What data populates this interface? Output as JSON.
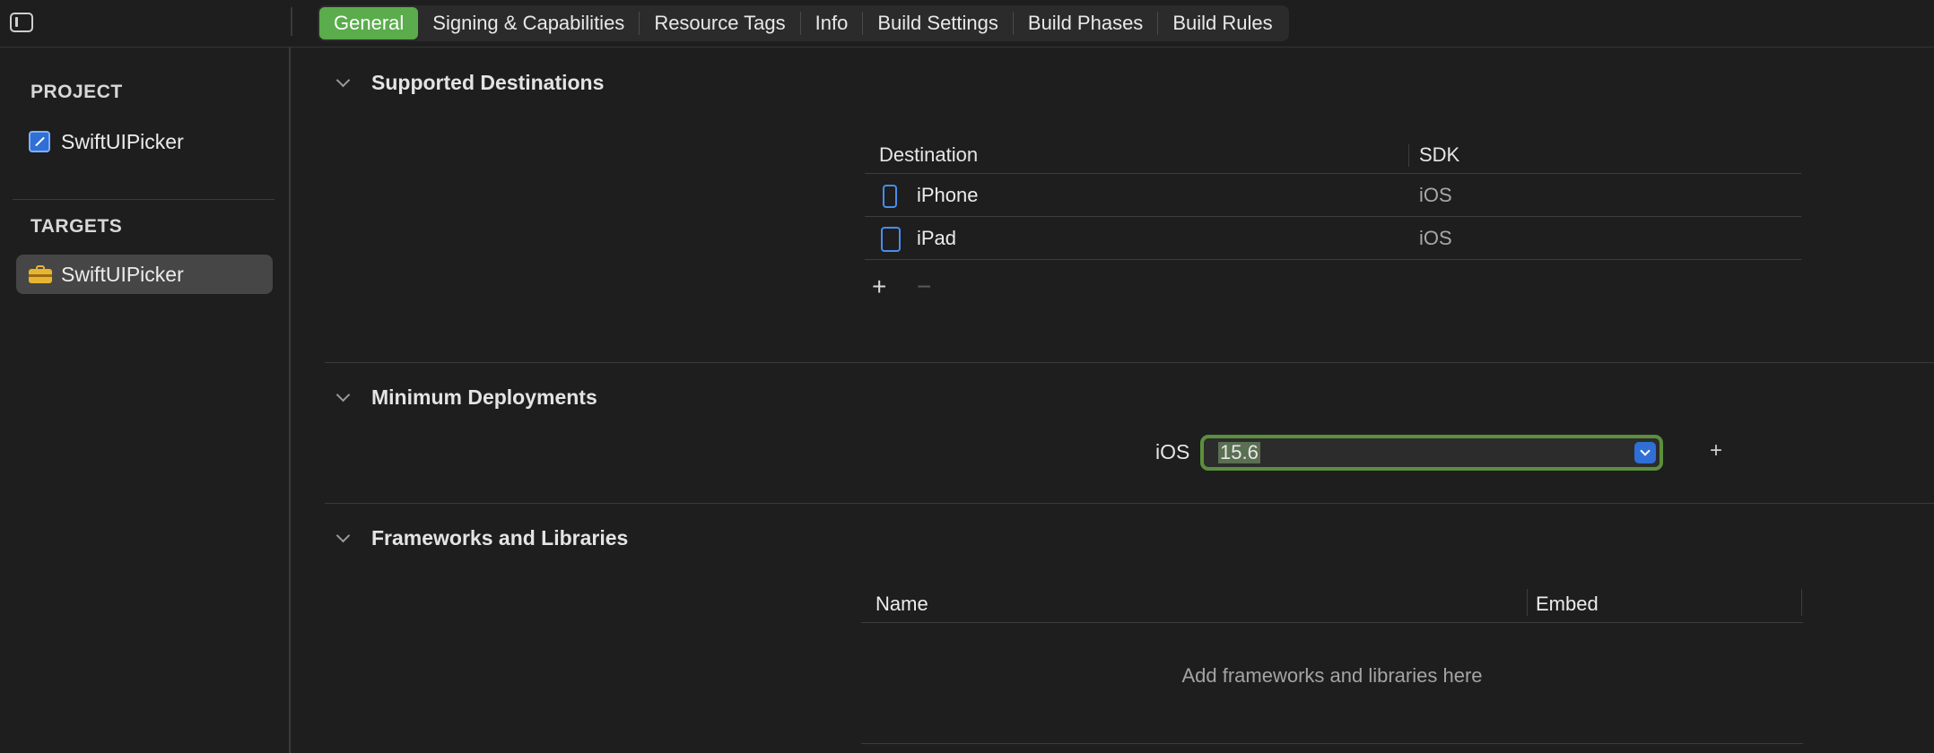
{
  "tabs": [
    "General",
    "Signing & Capabilities",
    "Resource Tags",
    "Info",
    "Build Settings",
    "Build Phases",
    "Build Rules"
  ],
  "active_tab": "General",
  "sidebar": {
    "project_heading": "PROJECT",
    "project_item": "SwiftUIPicker",
    "targets_heading": "TARGETS",
    "target_item": "SwiftUIPicker"
  },
  "supported_destinations": {
    "title": "Supported Destinations",
    "columns": [
      "Destination",
      "SDK"
    ],
    "rows": [
      {
        "destination": "iPhone",
        "sdk": "iOS",
        "icon": "iphone-icon"
      },
      {
        "destination": "iPad",
        "sdk": "iOS",
        "icon": "ipad-icon"
      }
    ],
    "add_label": "+",
    "remove_label": "−"
  },
  "minimum_deployments": {
    "title": "Minimum Deployments",
    "platform": "iOS",
    "version": "15.6",
    "add_label": "+"
  },
  "frameworks": {
    "title": "Frameworks and Libraries",
    "columns": [
      "Name",
      "Embed"
    ],
    "empty_text": "Add frameworks and libraries here"
  },
  "colors": {
    "accent_green": "#5aac4c",
    "focus_ring": "#5b8f3d",
    "device_blue": "#4a8cf0"
  }
}
